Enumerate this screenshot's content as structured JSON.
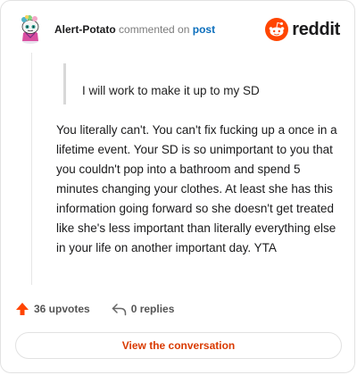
{
  "comment": {
    "username": "Alert-Potato",
    "verb": "commented on",
    "post_link": "post",
    "quote": "I will work to make it up to my SD",
    "body": "You literally can't. You can't fix fucking up a once in a lifetime event. Your SD is so unimportant to you that you couldn't pop into a bathroom and spend 5 minutes changing your clothes. At least she has this information going forward so she doesn't get treated like she's less important than literally everything else in your life on another important day. YTA"
  },
  "brand": {
    "wordmark": "reddit",
    "accent": "#ff4500"
  },
  "stats": {
    "upvotes": "36 upvotes",
    "replies": "0 replies"
  },
  "cta": {
    "label": "View the conversation",
    "color": "#d93a00"
  },
  "icons": {
    "avatar": "snoo-avatar",
    "logo": "reddit-alien-icon",
    "upvote": "upvote-arrow-icon",
    "reply": "reply-arrow-icon"
  }
}
